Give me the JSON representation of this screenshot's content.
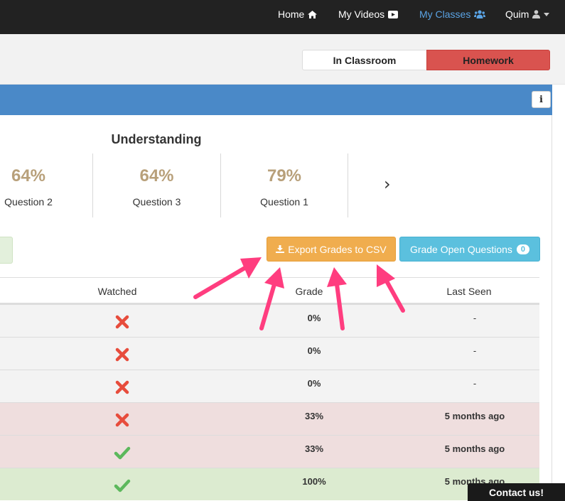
{
  "navbar": {
    "items": [
      {
        "label": "Home",
        "icon": "home-icon"
      },
      {
        "label": "My Videos",
        "icon": "video-icon"
      },
      {
        "label": "My Classes",
        "icon": "users-icon"
      },
      {
        "label": "Quim",
        "icon": "user-icon"
      }
    ],
    "active_color": "#5aa3e4"
  },
  "mode_toggle": {
    "in_classroom": "In Classroom",
    "homework": "Homework"
  },
  "info_button": "i",
  "understanding": {
    "title": "Understanding",
    "questions": [
      {
        "pct": "64%",
        "label": "Question 2"
      },
      {
        "pct": "64%",
        "label": "Question 3"
      },
      {
        "pct": "79%",
        "label": "Question 1"
      }
    ]
  },
  "actions": {
    "export_label": "Export Grades to CSV",
    "grade_open_label": "Grade Open Questions",
    "grade_open_count": "0"
  },
  "table": {
    "headers": {
      "watched": "Watched",
      "grade": "Grade",
      "last_seen": "Last Seen"
    },
    "rows": [
      {
        "watched": "no",
        "grade": "0%",
        "last_seen": "-",
        "status": "neutral"
      },
      {
        "watched": "no",
        "grade": "0%",
        "last_seen": "-",
        "status": "neutral"
      },
      {
        "watched": "no",
        "grade": "0%",
        "last_seen": "-",
        "status": "neutral"
      },
      {
        "watched": "no",
        "grade": "33%",
        "last_seen": "5 months ago",
        "status": "danger"
      },
      {
        "watched": "yes",
        "grade": "33%",
        "last_seen": "5 months ago",
        "status": "danger"
      },
      {
        "watched": "yes",
        "grade": "100%",
        "last_seen": "5 months ago",
        "status": "success"
      }
    ]
  },
  "contact_label": "Contact us!",
  "colors": {
    "navbar": "#222222",
    "panel_header": "#4a89c8",
    "homework": "#d9534f",
    "export": "#f0ad4e",
    "grade_open": "#5bc0de",
    "percent": "#b8a07a",
    "row_neutral": "#f3f3f3",
    "row_danger": "#efdede",
    "row_success": "#dcebd0",
    "cross": "#e74c3c",
    "check": "#5cb85c",
    "annotation_arrow": "#ff3d7f"
  }
}
